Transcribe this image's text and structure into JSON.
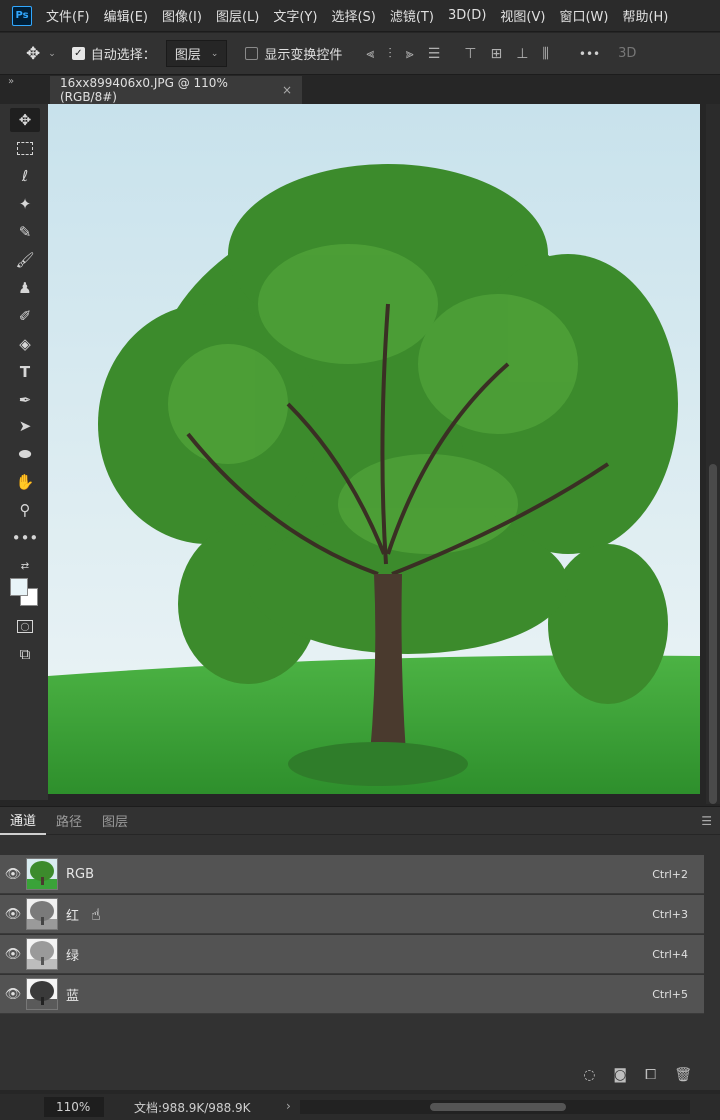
{
  "menubar": {
    "logo": "Ps",
    "items": [
      "文件(F)",
      "编辑(E)",
      "图像(I)",
      "图层(L)",
      "文字(Y)",
      "选择(S)",
      "滤镜(T)",
      "3D(D)",
      "视图(V)",
      "窗口(W)",
      "帮助(H)"
    ]
  },
  "options": {
    "auto_select_label": "自动选择：",
    "auto_select_value": "图层",
    "show_transform_label": "显示变换控件",
    "more": "•••",
    "three_d": "3D"
  },
  "document": {
    "tab_title": "16xx899406x0.JPG @ 110%(RGB/8#)",
    "close": "×"
  },
  "panel": {
    "tabs": [
      "通道",
      "路径",
      "图层"
    ],
    "channels": [
      {
        "name": "RGB",
        "shortcut": "Ctrl+2"
      },
      {
        "name": "红",
        "shortcut": "Ctrl+3"
      },
      {
        "name": "绿",
        "shortcut": "Ctrl+4"
      },
      {
        "name": "蓝",
        "shortcut": "Ctrl+5"
      }
    ]
  },
  "status": {
    "zoom": "110%",
    "doc_size": "文档:988.9K/988.9K",
    "arrow": "›"
  },
  "colors": {
    "sky_top": "#cfe6ee",
    "sky_bottom": "#eef5f7",
    "grass": "#3aa339",
    "foliage": "#3c8b2c",
    "trunk": "#4a3a2e"
  }
}
